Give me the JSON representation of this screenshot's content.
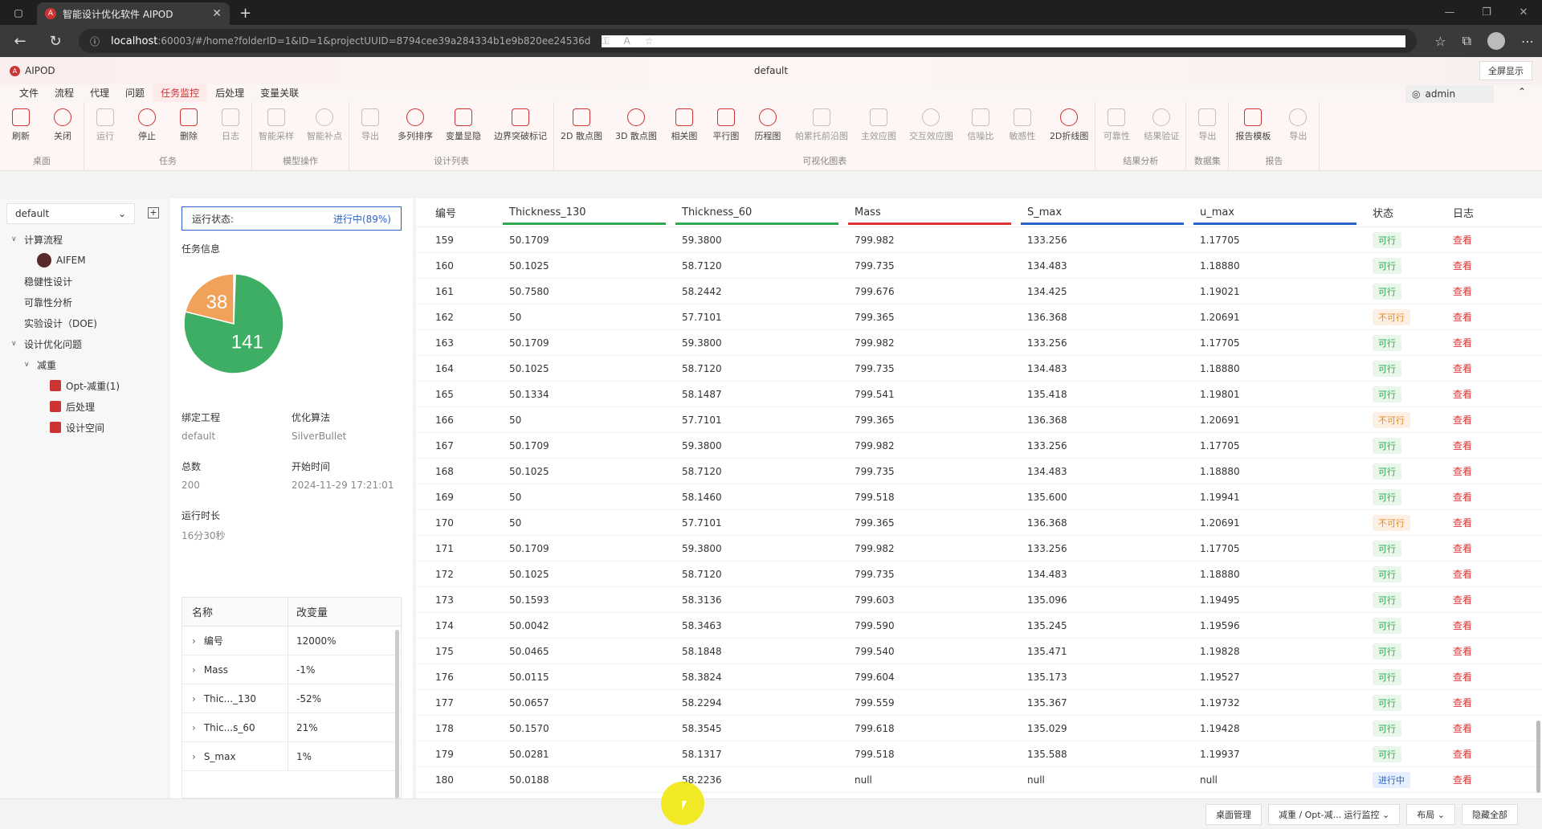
{
  "browser": {
    "tab_title": "智能设计优化软件 AIPOD",
    "url_host": "localhost",
    "url_path": ":60003/#/home?folderID=1&ID=1&projectUUID=8794cee39a284334b1e9b820ee24536d"
  },
  "app": {
    "name": "AIPOD",
    "project": "default",
    "fullscreen": "全屏显示",
    "user": "admin"
  },
  "menu": [
    "文件",
    "流程",
    "代理",
    "问题",
    "任务监控",
    "后处理",
    "变量关联"
  ],
  "ribbon": [
    {
      "label": "桌面",
      "buttons": [
        {
          "label": "刷新",
          "en": true
        },
        {
          "label": "关闭",
          "en": true
        }
      ]
    },
    {
      "label": "任务",
      "buttons": [
        {
          "label": "运行",
          "en": false
        },
        {
          "label": "停止",
          "en": true
        },
        {
          "label": "删除",
          "en": true
        },
        {
          "label": "日志",
          "en": false
        }
      ]
    },
    {
      "label": "模型操作",
      "buttons": [
        {
          "label": "智能采样",
          "en": false
        },
        {
          "label": "智能补点",
          "en": false
        }
      ]
    },
    {
      "label": "设计列表",
      "buttons": [
        {
          "label": "导出",
          "en": false
        },
        {
          "label": "多列排序",
          "en": true
        },
        {
          "label": "变量显隐",
          "en": true
        },
        {
          "label": "边界突破标记",
          "en": true
        }
      ]
    },
    {
      "label": "可视化图表",
      "buttons": [
        {
          "label": "2D 散点图",
          "en": true
        },
        {
          "label": "3D 散点图",
          "en": true
        },
        {
          "label": "相关图",
          "en": true
        },
        {
          "label": "平行图",
          "en": true
        },
        {
          "label": "历程图",
          "en": true
        },
        {
          "label": "帕累托前沿图",
          "en": false
        },
        {
          "label": "主效应图",
          "en": false
        },
        {
          "label": "交互效应图",
          "en": false
        },
        {
          "label": "信噪比",
          "en": false
        },
        {
          "label": "敏感性",
          "en": false
        },
        {
          "label": "2D折线图",
          "en": true
        }
      ]
    },
    {
      "label": "结果分析",
      "buttons": [
        {
          "label": "可靠性",
          "en": false
        },
        {
          "label": "结果验证",
          "en": false
        }
      ]
    },
    {
      "label": "数据集",
      "buttons": [
        {
          "label": "导出",
          "en": false
        }
      ]
    },
    {
      "label": "报告",
      "buttons": [
        {
          "label": "报告模板",
          "en": true
        },
        {
          "label": "导出",
          "en": false
        }
      ]
    }
  ],
  "sidebar": {
    "dropdown": "default",
    "tree": [
      {
        "label": "计算流程",
        "level": 0,
        "arrow": "∨"
      },
      {
        "label": "AIFEM",
        "level": 1,
        "icon": "avatar"
      },
      {
        "label": "稳健性设计",
        "level": 0
      },
      {
        "label": "可靠性分析",
        "level": 0
      },
      {
        "label": "实验设计（DOE)",
        "level": 0
      },
      {
        "label": "设计优化问题",
        "level": 0,
        "arrow": "∨"
      },
      {
        "label": "减重",
        "level": 1,
        "arrow": "∨"
      },
      {
        "label": "Opt-减重(1)",
        "level": 2,
        "icon": "box"
      },
      {
        "label": "后处理",
        "level": 2,
        "icon": "box"
      },
      {
        "label": "设计空间",
        "level": 2,
        "icon": "box"
      }
    ]
  },
  "monitor": {
    "status_label": "运行状态:",
    "status_value": "进行中(89%)",
    "task_info": "任务信息",
    "pie": {
      "feasible": 141,
      "infeasible": 38,
      "pending": 1
    },
    "fields": [
      {
        "k": "绑定工程",
        "v": "default"
      },
      {
        "k": "优化算法",
        "v": "SilverBullet"
      },
      {
        "k": "总数",
        "v": "200"
      },
      {
        "k": "开始时间",
        "v": "2024-11-29 17:21:01"
      },
      {
        "k": "运行时长",
        "v": "16分30秒"
      }
    ],
    "change_table": {
      "headers": [
        "名称",
        "改变量"
      ],
      "rows": [
        [
          "编号",
          "12000%"
        ],
        [
          "Mass",
          "-1%"
        ],
        [
          "Thic..._130",
          "-52%"
        ],
        [
          "Thic...s_60",
          "21%"
        ],
        [
          "S_max",
          "1%"
        ]
      ]
    }
  },
  "table": {
    "headers": [
      "编号",
      "Thickness_130",
      "Thickness_60",
      "Mass",
      "S_max",
      "u_max",
      "状态",
      "日志"
    ],
    "bar_colors": [
      "#2fa84f",
      "#2fa84f",
      "#d33",
      "#2a63c9",
      "#2a63c9"
    ],
    "log_text": "查看",
    "rows": [
      [
        "159",
        "50.1709",
        "59.3800",
        "799.982",
        "133.256",
        "1.17705",
        "可行"
      ],
      [
        "160",
        "50.1025",
        "58.7120",
        "799.735",
        "134.483",
        "1.18880",
        "可行"
      ],
      [
        "161",
        "50.7580",
        "58.2442",
        "799.676",
        "134.425",
        "1.19021",
        "可行"
      ],
      [
        "162",
        "50",
        "57.7101",
        "799.365",
        "136.368",
        "1.20691",
        "不可行"
      ],
      [
        "163",
        "50.1709",
        "59.3800",
        "799.982",
        "133.256",
        "1.17705",
        "可行"
      ],
      [
        "164",
        "50.1025",
        "58.7120",
        "799.735",
        "134.483",
        "1.18880",
        "可行"
      ],
      [
        "165",
        "50.1334",
        "58.1487",
        "799.541",
        "135.418",
        "1.19801",
        "可行"
      ],
      [
        "166",
        "50",
        "57.7101",
        "799.365",
        "136.368",
        "1.20691",
        "不可行"
      ],
      [
        "167",
        "50.1709",
        "59.3800",
        "799.982",
        "133.256",
        "1.17705",
        "可行"
      ],
      [
        "168",
        "50.1025",
        "58.7120",
        "799.735",
        "134.483",
        "1.18880",
        "可行"
      ],
      [
        "169",
        "50",
        "58.1460",
        "799.518",
        "135.600",
        "1.19941",
        "可行"
      ],
      [
        "170",
        "50",
        "57.7101",
        "799.365",
        "136.368",
        "1.20691",
        "不可行"
      ],
      [
        "171",
        "50.1709",
        "59.3800",
        "799.982",
        "133.256",
        "1.17705",
        "可行"
      ],
      [
        "172",
        "50.1025",
        "58.7120",
        "799.735",
        "134.483",
        "1.18880",
        "可行"
      ],
      [
        "173",
        "50.1593",
        "58.3136",
        "799.603",
        "135.096",
        "1.19495",
        "可行"
      ],
      [
        "174",
        "50.0042",
        "58.3463",
        "799.590",
        "135.245",
        "1.19596",
        "可行"
      ],
      [
        "175",
        "50.0465",
        "58.1848",
        "799.540",
        "135.471",
        "1.19828",
        "可行"
      ],
      [
        "176",
        "50.0115",
        "58.3824",
        "799.604",
        "135.173",
        "1.19527",
        "可行"
      ],
      [
        "177",
        "50.0657",
        "58.2294",
        "799.559",
        "135.367",
        "1.19732",
        "可行"
      ],
      [
        "178",
        "50.1570",
        "58.3545",
        "799.618",
        "135.029",
        "1.19428",
        "可行"
      ],
      [
        "179",
        "50.0281",
        "58.1317",
        "799.518",
        "135.588",
        "1.19937",
        "可行"
      ],
      [
        "180",
        "50.0188",
        "58.2236",
        "null",
        "null",
        "null",
        "进行中"
      ]
    ]
  },
  "footer": [
    "桌面管理",
    "减重 / Opt-减... 运行监控 ⌄",
    "布局 ⌄",
    "隐藏全部"
  ]
}
